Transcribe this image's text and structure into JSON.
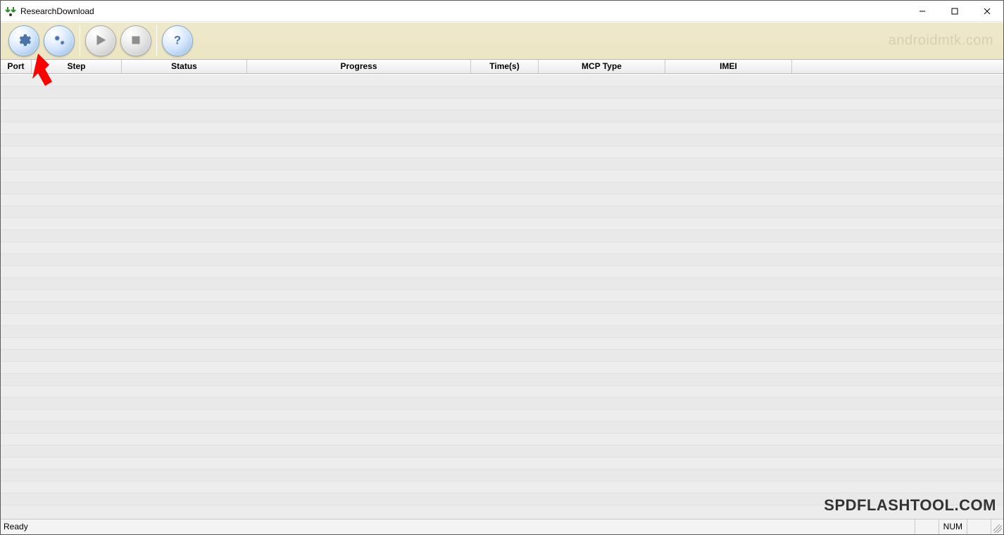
{
  "window": {
    "title": "ResearchDownload"
  },
  "toolbar": {
    "watermark": "androidmtk.com"
  },
  "columns": {
    "port": "Port",
    "step": "Step",
    "status": "Status",
    "progress": "Progress",
    "time": "Time(s)",
    "mcp": "MCP Type",
    "imei": "IMEI"
  },
  "statusbar": {
    "ready": "Ready",
    "num": "NUM"
  },
  "watermark_bottom": "SPDFLASHTOOL.COM"
}
